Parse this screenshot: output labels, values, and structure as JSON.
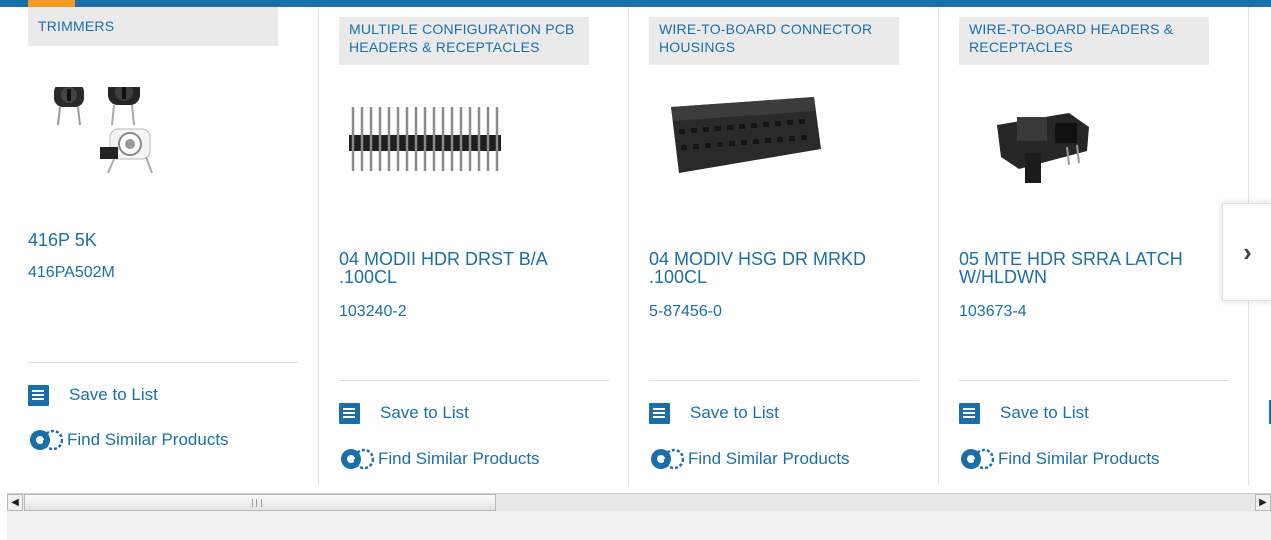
{
  "colors": {
    "link": "#1a6fa9",
    "accent_bar": "#1a6fa9",
    "accent_orange": "#f29a1f",
    "label_bg": "#eaeaea"
  },
  "cards": [
    {
      "category": "TRIMMERS",
      "name": "416P 5K",
      "part": "416PA502M",
      "save_label": "Save to List",
      "similar_label": "Find Similar Products"
    },
    {
      "category": "MULTIPLE CONFIGURATION PCB HEADERS & RECEPTACLES",
      "name": "04 MODII HDR DRST B/A .100CL",
      "part": "103240-2",
      "save_label": "Save to List",
      "similar_label": "Find Similar Products"
    },
    {
      "category": "WIRE-TO-BOARD CONNECTOR HOUSINGS",
      "name": "04 MODIV HSG DR MRKD .100CL",
      "part": "5-87456-0",
      "save_label": "Save to List",
      "similar_label": "Find Similar Products"
    },
    {
      "category": "WIRE-TO-BOARD HEADERS & RECEPTACLES",
      "name": "05 MTE HDR SRRA LATCH W/HLDWN",
      "part": "103673-4",
      "save_label": "Save to List",
      "similar_label": "Find Similar Products"
    }
  ],
  "icons": {
    "save": "checklist-icon",
    "similar": "gears-icon",
    "next": "chevron-right-icon"
  },
  "nav": {
    "next_glyph": "›"
  },
  "scrollbar": {
    "left_glyph": "◀",
    "right_glyph": "▶"
  }
}
